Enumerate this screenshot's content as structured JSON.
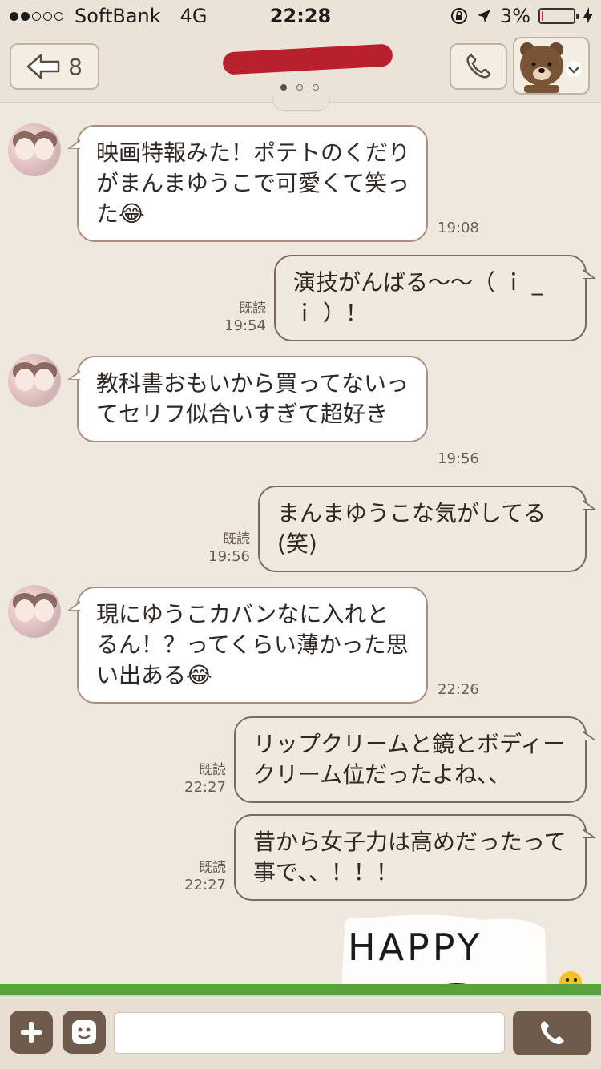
{
  "status_bar": {
    "carrier": "SoftBank",
    "network": "4G",
    "time": "22:28",
    "battery_percent": "3%",
    "battery_level": 0.03,
    "signal_bars_on": 2,
    "signal_bars_total": 5
  },
  "nav": {
    "back_count": "8",
    "title_redacted": true,
    "page_dots": 3,
    "active_page": 0
  },
  "messages": [
    {
      "direction": "in",
      "text": "映画特報みた！ポテトのくだりがまんまゆうこで可愛くて笑った",
      "emoji": "😂",
      "time": "19:08"
    },
    {
      "direction": "out",
      "text": "演技がんばる〜〜（ ｉ _ ｉ ）！",
      "read": "既読",
      "time": "19:54"
    },
    {
      "direction": "in",
      "text": "教科書おもいから買ってないってセリフ似合いすぎて超好き",
      "time": "19:56"
    },
    {
      "direction": "out",
      "text": "まんまゆうこな気がしてる(笑)",
      "read": "既読",
      "time": "19:56"
    },
    {
      "direction": "in",
      "text": "現にゆうこカバンなに入れとるん！？ってくらい薄かった思い出ある",
      "emoji": "😂",
      "time": "22:26"
    },
    {
      "direction": "out",
      "text": "リップクリームと鏡とボディークリーム位だったよね、、",
      "read": "既読",
      "time": "22:27"
    },
    {
      "direction": "out",
      "text": "昔から女子力は高めだったって事で、、！！！",
      "read": "既読",
      "time": "22:27"
    }
  ],
  "sticker": {
    "text": "HAPPY"
  },
  "input_bar": {
    "plus_icon": "plus-icon",
    "emoji_icon": "emoji-icon",
    "input_value": "",
    "call_icon": "phone-icon"
  },
  "colors": {
    "background": "#efe8de",
    "incoming_bubble": "#ffffff",
    "outgoing_bubble": "#efe9de",
    "accent_brown": "#6e5b4c"
  }
}
